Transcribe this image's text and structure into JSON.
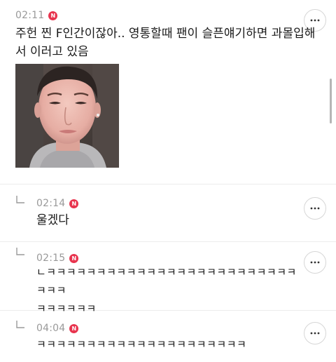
{
  "colors": {
    "badge": "#e8344e",
    "time": "#999999",
    "divider": "#ececec",
    "text": "#1a1a1a"
  },
  "badge_letter": "N",
  "comments": [
    {
      "time": "02:11",
      "lines": [
        "주헌 찐 F인간이잖아.. 영통할때 팬이 슬픈얘기하면 과몰입해",
        "서 이러고 있음"
      ],
      "has_image": true
    },
    {
      "time": "02:14",
      "lines": [
        "울겠다"
      ],
      "is_reply": true
    },
    {
      "time": "02:15",
      "lines": [
        "ㄴㅋㅋㅋㅋㅋㅋㅋㅋㅋㅋㅋㅋㅋㅋㅋㅋㅋㅋㅋㅋㅋㅋㅋㅋㅋㅋㅋㅋ",
        "ㅋㅋㅋㅋㅋㅋ"
      ],
      "is_reply": true
    },
    {
      "time": "04:04",
      "lines": [
        "ㅋㅋㅋㅋㅋㅋㅋㅋㅋㅋㅋㅋㅋㅋㅋㅋㅋㅋㅋㅋㅋ"
      ],
      "is_reply": true
    }
  ],
  "icons": {
    "badge": "new-badge-icon",
    "more": "more-options-icon",
    "reply": "reply-arrow-icon"
  }
}
